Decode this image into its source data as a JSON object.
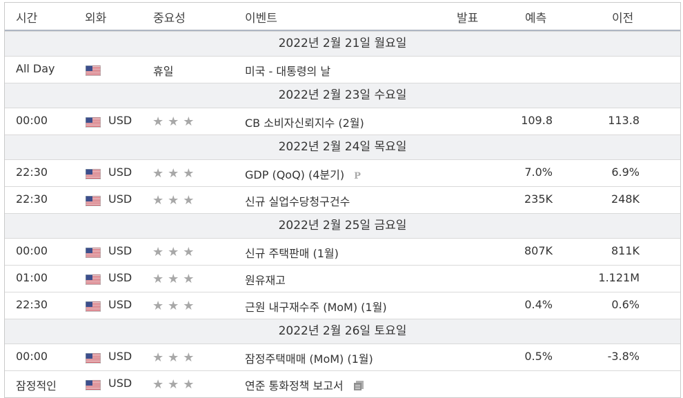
{
  "headers": {
    "time": "시간",
    "currency": "외화",
    "importance": "중요성",
    "event": "이벤트",
    "actual": "발표",
    "forecast": "예측",
    "previous": "이전"
  },
  "days": [
    {
      "date": "2022년 2월 21일 월요일",
      "rows": [
        {
          "time": "All Day",
          "currency": "",
          "importance": "휴일",
          "event": "미국 - 대통령의 날",
          "forecast": "",
          "previous": "",
          "stars": false,
          "icon": ""
        }
      ]
    },
    {
      "date": "2022년 2월 23일 수요일",
      "rows": [
        {
          "time": "00:00",
          "currency": "USD",
          "importance": "",
          "event": "CB 소비자신뢰지수 (2월)",
          "forecast": "109.8",
          "previous": "113.8",
          "stars": true,
          "icon": ""
        }
      ]
    },
    {
      "date": "2022년 2월 24일 목요일",
      "rows": [
        {
          "time": "22:30",
          "currency": "USD",
          "importance": "",
          "event": "GDP (QoQ) (4분기)",
          "forecast": "7.0%",
          "previous": "6.9%",
          "stars": true,
          "icon": "preliminary-icon"
        },
        {
          "time": "22:30",
          "currency": "USD",
          "importance": "",
          "event": "신규 실업수당청구건수",
          "forecast": "235K",
          "previous": "248K",
          "stars": true,
          "icon": ""
        }
      ]
    },
    {
      "date": "2022년 2월 25일 금요일",
      "rows": [
        {
          "time": "00:00",
          "currency": "USD",
          "importance": "",
          "event": "신규 주택판매 (1월)",
          "forecast": "807K",
          "previous": "811K",
          "stars": true,
          "icon": ""
        },
        {
          "time": "01:00",
          "currency": "USD",
          "importance": "",
          "event": "원유재고",
          "forecast": "",
          "previous": "1.121M",
          "stars": true,
          "icon": ""
        },
        {
          "time": "22:30",
          "currency": "USD",
          "importance": "",
          "event": "근원 내구재수주 (MoM) (1월)",
          "forecast": "0.4%",
          "previous": "0.6%",
          "stars": true,
          "icon": ""
        }
      ]
    },
    {
      "date": "2022년 2월 26일 토요일",
      "rows": [
        {
          "time": "00:00",
          "currency": "USD",
          "importance": "",
          "event": "잠정주택매매 (MoM) (1월)",
          "forecast": "0.5%",
          "previous": "-3.8%",
          "stars": true,
          "icon": ""
        },
        {
          "time": "잠정적인",
          "currency": "USD",
          "importance": "",
          "event": "연준 통화정책 보고서",
          "forecast": "",
          "previous": "",
          "stars": true,
          "icon": "report-document-icon"
        }
      ]
    }
  ],
  "star_glyph": "★",
  "preliminary_glyph": "P",
  "colors": {
    "star": "#a8a8a8",
    "day_band": "#f0f1f3",
    "header_rule": "#aeb6c2"
  }
}
